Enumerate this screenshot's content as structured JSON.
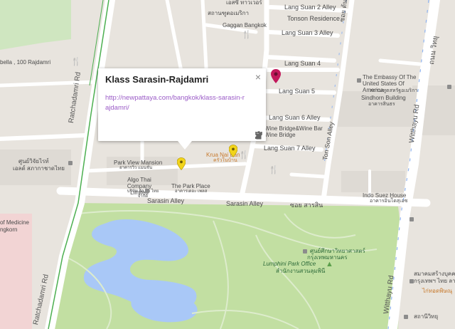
{
  "popup": {
    "title": "Klass Sarasin-Rajdamri",
    "link": "http://newpattaya.com/bangkok/klass-sarasin-rajdamri/",
    "close_symbol": "×",
    "tools": [
      "edit-icon",
      "directions-icon",
      "delete-icon"
    ]
  },
  "labels": {
    "top_thai": "เอสซี ทาวเวอร์",
    "lang_suan_2": "Lang Suan 2 Alley",
    "tonson": "Tonson Residence",
    "tonson_thai": "สถานฑูตอเมริกา",
    "gaggan": "Gaggan Bangkok",
    "lang_suan_3": "Lang Suan 3 Alley",
    "lang_suan_4": "Lang Suan 4",
    "lang_suan_5": "Lang Suan 5",
    "lang_suan_6": "Lang Suan 6 Alley",
    "lang_suan_7": "Lang Suan 7 Alley",
    "embassy": "The Embassy Of The United States Of America",
    "embassy_thai": "สถานฑูตสหรัฐอเมริกา",
    "sindhorn": "Sindhorn Building",
    "sindhorn_thai": "อาคารสินธร",
    "wine": "Wine Bridge&Wine Bar Wine Bridge",
    "krua": "Krua Nai Ban",
    "krua_thai": "ครัวในบ้าน",
    "park_view": "Park View Mansion",
    "park_view_thai": "อาคารวิว แมนชั่น",
    "algo": "Algo Thai Company Limited",
    "algo_thai": "บริษัท อัล โก ไทย จำกัด",
    "park_place": "The Park Place",
    "park_place_thai": "อาคารเดอะ เพลส",
    "indo": "Indo Suez House",
    "indo_thai": "อาคารอินโดสุเอซ",
    "ratcha_road": "Ratchadamri Rd",
    "ratcha_road2": "Ratchadamri Rd",
    "ton_son_alley": "Ton Son Alley",
    "witthayu": "Witthayu Rd",
    "witthayu_thai": "ถนน วิทยุ",
    "soi_thai": "ซอย ต้นสน",
    "sarasin1": "Sarasin Alley",
    "sarasin2": "Sarasin Alley",
    "sarasin_thai": "ซอย สารสิน",
    "rajdamri": "bella , 100 Rajdamri",
    "left_thai1": "ศูนย์วิจัยไรท์",
    "left_thai2": "เอลด์ สภากาชาดไทย",
    "medicine1": "of Medicine",
    "medicine2": "ngkorn",
    "thai_mid1": "ศูนย์ศึกษาวิทยาศาสตร์",
    "thai_mid2": "กรุงเทพมหานคร",
    "lumphini": "Lumphini Park Office",
    "lumphini_thai": "สำนักงานสวนลุมพินี",
    "br_thai1": "สมาคมสร้างบุคคล",
    "br_thai2": "กรุงเทพฯ ไทย ลาว",
    "br_thai3": "ไก่ทอดพิษณุ",
    "br_thai4": "สถานีวิทยุ"
  },
  "colors": {
    "land": "#e8e4de",
    "road": "#ffffff",
    "park": "#c2dfa2",
    "water": "#a9c8f7",
    "pin_selected": "#c2185b",
    "pin_yellow": "#f2d41a",
    "link": "#9b5cc7"
  }
}
